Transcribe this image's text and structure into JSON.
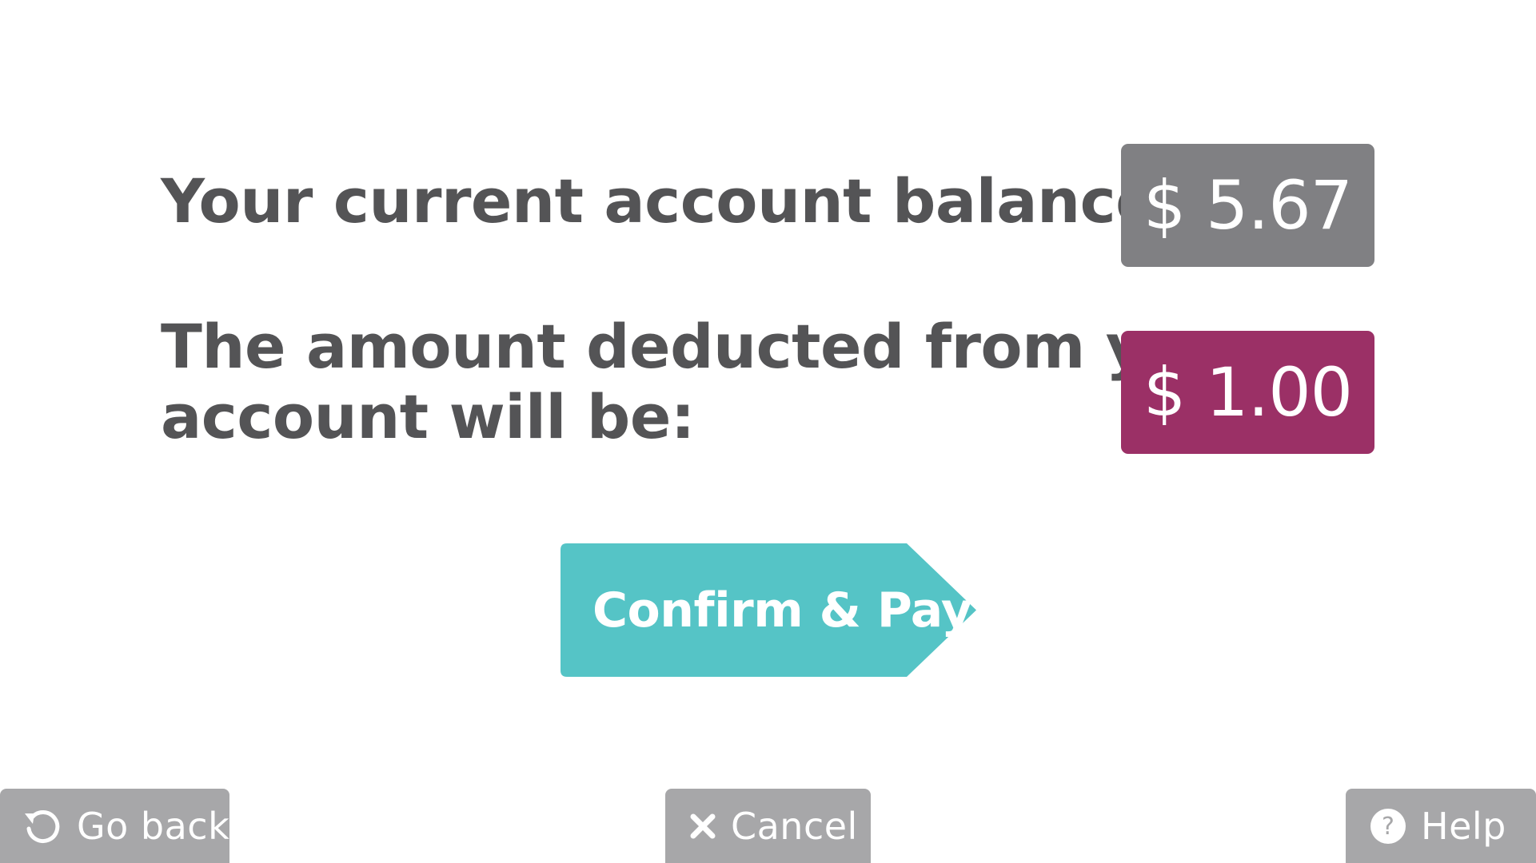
{
  "balance": {
    "label": "Your current account balance is:",
    "amount": "$ 5.67",
    "color": "#808083"
  },
  "deduction": {
    "label_line1": "The amount deducted from your",
    "label_line2": "account will be:",
    "amount": "$ 1.00",
    "color": "#9b3066"
  },
  "confirm": {
    "label": "Confirm & Pay",
    "color": "#55c4c6"
  },
  "footer": {
    "go_back": {
      "label": "Go back",
      "icon": "undo-icon"
    },
    "cancel": {
      "label": "Cancel",
      "icon": "close-icon"
    },
    "help": {
      "label": "Help",
      "icon": "help-icon"
    },
    "color": "#a7a7a9"
  }
}
